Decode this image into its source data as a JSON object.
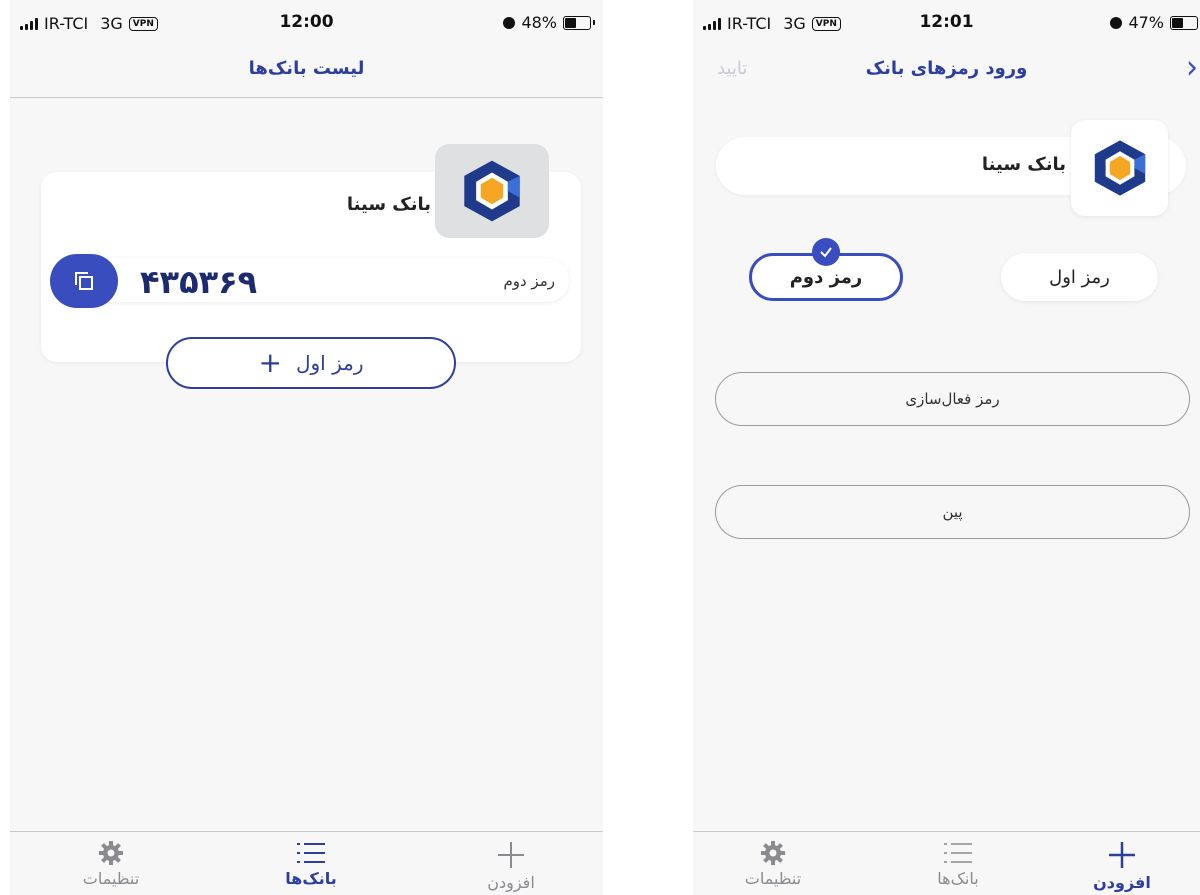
{
  "left_screen": {
    "status": {
      "carrier": "IR-TCI",
      "network": "3G",
      "vpn": "VPN",
      "time": "12:00",
      "battery": "48%",
      "battery_level": 0.48
    },
    "nav": {
      "title": "لیست بانک‌ها"
    },
    "card": {
      "bank_name": "بانک سینا",
      "password_label": "رمز دوم",
      "password_value": "۴۳۵۳۶۹",
      "add_button_label": "رمز اول",
      "add_icon": "plus-icon",
      "copy_icon": "copy-icon"
    },
    "tabs": [
      {
        "label": "تنظیمات",
        "icon": "gear-icon",
        "active": false
      },
      {
        "label": "بانک‌ها",
        "icon": "list-icon",
        "active": true
      },
      {
        "label": "افزودن",
        "icon": "plus-icon",
        "active": false
      }
    ]
  },
  "right_screen": {
    "status": {
      "carrier": "IR-TCI",
      "network": "3G",
      "vpn": "VPN",
      "time": "12:01",
      "battery": "47%",
      "battery_level": 0.47
    },
    "nav": {
      "title": "ورود رمزهای بانک",
      "confirm_label": "تایید",
      "back_icon": "chevron-right-icon"
    },
    "bank_name": "بانک سینا",
    "password_types": [
      {
        "label": "رمز دوم",
        "selected": true
      },
      {
        "label": "رمز اول",
        "selected": false
      }
    ],
    "fields": [
      {
        "placeholder": "رمز فعال‌سازی"
      },
      {
        "placeholder": "پین"
      }
    ],
    "tabs": [
      {
        "label": "تنظیمات",
        "icon": "gear-icon",
        "active": false
      },
      {
        "label": "بانک‌ها",
        "icon": "list-icon",
        "active": false
      },
      {
        "label": "افزودن",
        "icon": "plus-icon",
        "active": true
      }
    ]
  },
  "colors": {
    "accent": "#3a4dbf",
    "title": "#2c3e9e",
    "logo_navy": "#1f3a8a",
    "logo_orange": "#f5a623"
  }
}
